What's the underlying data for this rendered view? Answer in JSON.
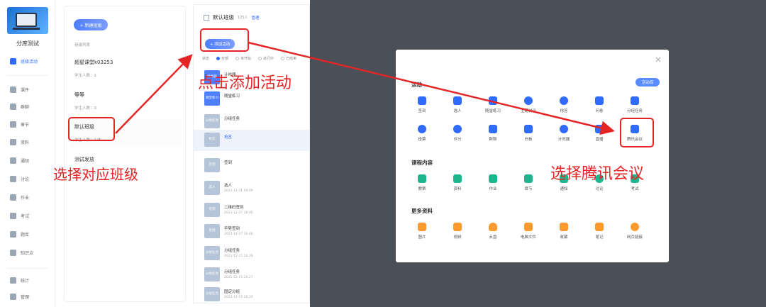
{
  "nav": {
    "course_name": "分库测试",
    "items": [
      {
        "label": "班级活动",
        "active": true
      },
      {
        "label": "课件"
      },
      {
        "label": "群聊"
      },
      {
        "label": "章节"
      },
      {
        "label": "资料"
      },
      {
        "label": "通知"
      },
      {
        "label": "讨论"
      },
      {
        "label": "作业"
      },
      {
        "label": "考试"
      },
      {
        "label": "题库"
      },
      {
        "label": "知识点"
      },
      {
        "label": "统计"
      },
      {
        "label": "管理"
      }
    ]
  },
  "class_panel": {
    "new_class_label": "+ 新建班级",
    "list_title": "班级列表",
    "classes": [
      {
        "name": "超星课堂k03253",
        "students": "学生人数：1"
      },
      {
        "name": "等等",
        "students": "学生人数：0"
      },
      {
        "name": "默认班级",
        "students": "学生人数：125"
      },
      {
        "name": "测试发放",
        "students": "学生人数：2"
      }
    ]
  },
  "activity_panel": {
    "class_title": "默认班级",
    "count": "125人",
    "manage_label": "管理",
    "add_activity_label": "+ 添加活动",
    "filter_label": "状态",
    "filters": [
      "全部",
      "未开始",
      "进行中",
      "已结束"
    ],
    "items": [
      {
        "icon": "计时器",
        "title": "计时器",
        "date": ""
      },
      {
        "icon": "随堂练习",
        "title": "随堂练习",
        "date": ""
      },
      {
        "icon": "分组任务",
        "title": "分组任务",
        "date": ""
      },
      {
        "icon": "抢答",
        "title": "抢答",
        "date": "",
        "highlighted": true
      },
      {
        "icon": "签到",
        "title": "签到",
        "date": ""
      },
      {
        "icon": "选人",
        "title": "选人",
        "date": "2021-12-31 09:09"
      },
      {
        "icon": "签到",
        "title": "二维码签到",
        "date": "2021-12-27 16:46"
      },
      {
        "icon": "签到",
        "title": "手势签到",
        "date": "2021-12-27 16:46"
      },
      {
        "icon": "分组任务",
        "title": "分组任务",
        "date": "2021-12-15 16:28"
      },
      {
        "icon": "分组任务",
        "title": "分组任务",
        "date": "2021-12-15 16:27"
      },
      {
        "icon": "分组任务",
        "title": "固定分组",
        "date": "2021-12-15 16:26"
      }
    ]
  },
  "modal": {
    "close": "×",
    "library_label": "活动库",
    "sections": [
      {
        "title": "活动",
        "tiles": [
          {
            "label": "签到",
            "icon": "sign-in-icon",
            "color": "#2f6bff"
          },
          {
            "label": "选人",
            "icon": "person-icon",
            "color": "#2f6bff"
          },
          {
            "label": "随堂练习",
            "icon": "practice-icon",
            "color": "#2f6bff"
          },
          {
            "label": "主题讨论",
            "icon": "discussion-icon",
            "color": "#2f6bff"
          },
          {
            "label": "抢答",
            "icon": "microphone-icon",
            "color": "#2f6bff"
          },
          {
            "label": "问卷",
            "icon": "questionnaire-icon",
            "color": "#2f6bff"
          },
          {
            "label": "分组任务",
            "icon": "group-task-icon",
            "color": "#2f6bff"
          },
          {
            "label": "投票",
            "icon": "vote-icon",
            "color": "#2f6bff"
          },
          {
            "label": "评分",
            "icon": "rating-icon",
            "color": "#2f6bff"
          },
          {
            "label": "群聊",
            "icon": "group-chat-icon",
            "color": "#2f6bff"
          },
          {
            "label": "白板",
            "icon": "whiteboard-icon",
            "color": "#2f6bff"
          },
          {
            "label": "计时器",
            "icon": "timer-icon",
            "color": "#2f6bff"
          },
          {
            "label": "直播",
            "icon": "live-icon",
            "color": "#2f6bff"
          },
          {
            "label": "腾讯会议",
            "icon": "tencent-meeting-icon",
            "color": "#2f6bff"
          }
        ]
      },
      {
        "title": "课程内容",
        "tiles": [
          {
            "label": "教案",
            "icon": "lesson-plan-icon",
            "color": "#1fb58f"
          },
          {
            "label": "资料",
            "icon": "folder-icon",
            "color": "#1fb58f"
          },
          {
            "label": "作业",
            "icon": "homework-icon",
            "color": "#1fb58f"
          },
          {
            "label": "章节",
            "icon": "chapter-icon",
            "color": "#1fb58f"
          },
          {
            "label": "通知",
            "icon": "notice-icon",
            "color": "#1fb58f"
          },
          {
            "label": "讨论",
            "icon": "discuss-icon",
            "color": "#1fb58f"
          },
          {
            "label": "考试",
            "icon": "exam-icon",
            "color": "#1fb58f"
          }
        ]
      },
      {
        "title": "更多资料",
        "tiles": [
          {
            "label": "图片",
            "icon": "image-icon",
            "color": "#ff9a2e"
          },
          {
            "label": "视频",
            "icon": "video-icon",
            "color": "#ff9a2e"
          },
          {
            "label": "云盘",
            "icon": "cloud-icon",
            "color": "#ff9a2e"
          },
          {
            "label": "电脑文件",
            "icon": "computer-file-icon",
            "color": "#ff9a2e"
          },
          {
            "label": "收藏",
            "icon": "favorite-icon",
            "color": "#ff9a2e"
          },
          {
            "label": "笔记",
            "icon": "note-icon",
            "color": "#ff9a2e"
          },
          {
            "label": "网页链接",
            "icon": "link-icon",
            "color": "#ff9a2e"
          }
        ]
      }
    ]
  },
  "annotations": {
    "click_add_activity": "点击添加活动",
    "select_class": "选择对应班级",
    "select_tencent": "选择腾讯会议",
    "color": "#e52525"
  }
}
